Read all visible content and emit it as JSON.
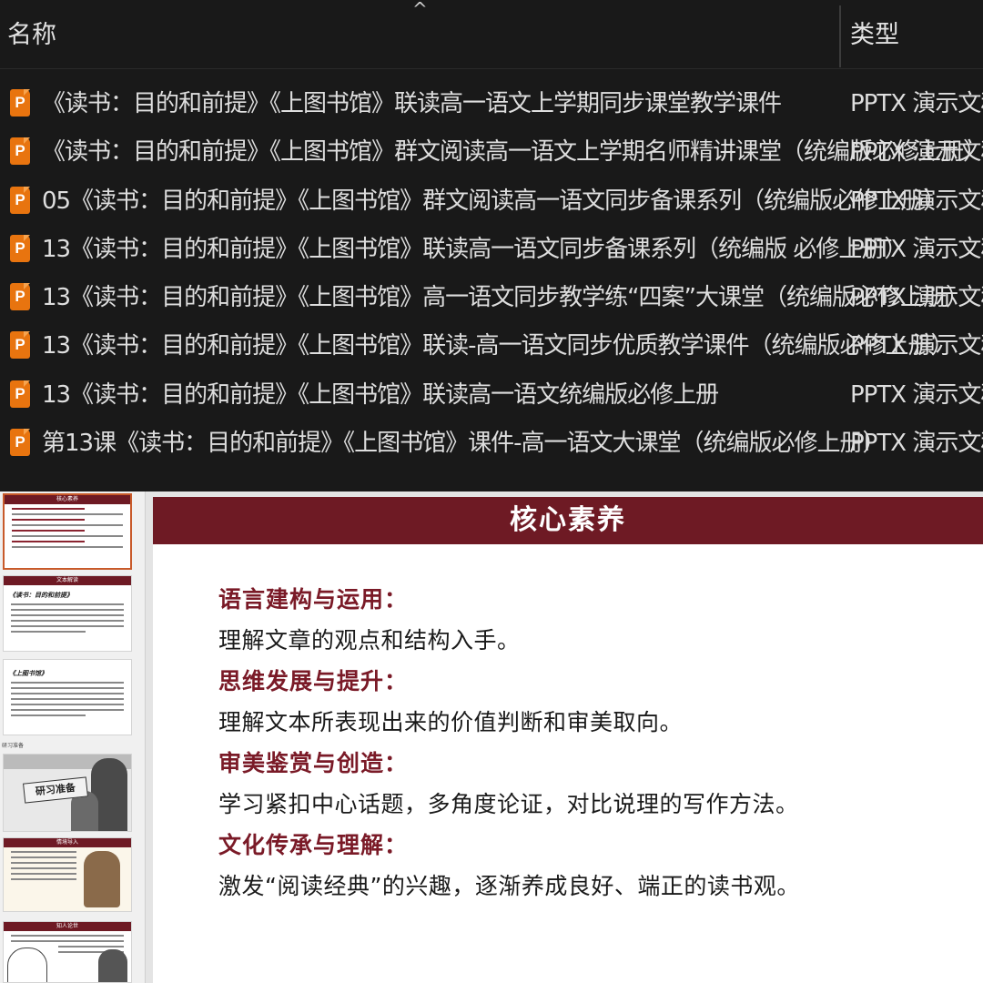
{
  "explorer": {
    "columns": {
      "name": "名称",
      "type": "类型"
    },
    "sort_indicator": "^",
    "files": [
      {
        "name": "《读书：目的和前提》《上图书馆》联读高一语文上学期同步课堂教学课件",
        "type": "PPTX 演示文稿"
      },
      {
        "name": "《读书：目的和前提》《上图书馆》群文阅读高一语文上学期名师精讲课堂（统编版必修上册）",
        "type": "PPTX 演示文稿"
      },
      {
        "name": "05《读书：目的和前提》《上图书馆》群文阅读高一语文同步备课系列（统编版必修上册）",
        "type": "PPTX 演示文稿"
      },
      {
        "name": "13《读书：目的和前提》《上图书馆》联读高一语文同步备课系列（统编版 必修上册）",
        "type": "PPTX 演示文稿"
      },
      {
        "name": "13《读书：目的和前提》《上图书馆》高一语文同步教学练“四案”大课堂（统编版必修上册）",
        "type": "PPTX 演示文稿"
      },
      {
        "name": "13《读书：目的和前提》《上图书馆》联读-高一语文同步优质教学课件（统编版必修上册）",
        "type": "PPTX 演示文稿"
      },
      {
        "name": "13《读书：目的和前提》《上图书馆》联读高一语文统编版必修上册",
        "type": "PPTX 演示文稿"
      },
      {
        "name": "第13课《读书：目的和前提》《上图书馆》课件-高一语文大课堂（统编版必修上册）",
        "type": "PPTX 演示文稿"
      }
    ],
    "icon": "powerpoint-file-icon",
    "icon_letter": "P",
    "icon_color": "#e8740f"
  },
  "thumbnails": {
    "slide1_title": "核心素养",
    "slide2_title": "文本解读",
    "slide2_heading": "《读书：目的和前提》",
    "slide3_heading": "《上图书馆》",
    "slide4_label": "研习准备",
    "slide4_ribbon": "研习准备",
    "slide5_title": "情境导入",
    "slide6_title": "知人论世"
  },
  "slide": {
    "title": "核心素养",
    "header_color": "#6e1a24",
    "sections": [
      {
        "heading": "语言建构与运用：",
        "text": "理解文章的观点和结构入手。"
      },
      {
        "heading": "思维发展与提升：",
        "text": "理解文本所表现出来的价值判断和审美取向。"
      },
      {
        "heading": "审美鉴赏与创造：",
        "text": "学习紧扣中心话题，多角度论证，对比说理的写作方法。"
      },
      {
        "heading": "文化传承与理解：",
        "text": "激发“阅读经典”的兴趣，逐渐养成良好、端正的读书观。"
      }
    ]
  }
}
